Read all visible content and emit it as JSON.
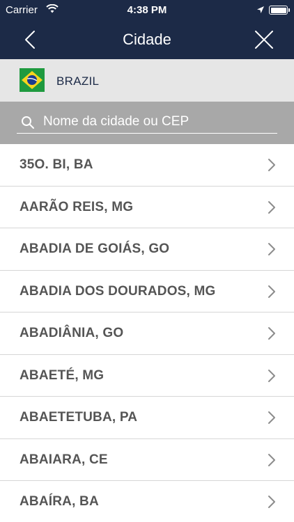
{
  "status_bar": {
    "carrier": "Carrier",
    "time": "4:38 PM"
  },
  "nav": {
    "title": "Cidade"
  },
  "country": {
    "name": "BRAZIL"
  },
  "search": {
    "placeholder": "Nome da cidade ou CEP"
  },
  "cities": [
    {
      "label": "35O. BI, BA"
    },
    {
      "label": "AARÃO REIS, MG"
    },
    {
      "label": "ABADIA DE GOIÁS, GO"
    },
    {
      "label": "ABADIA DOS DOURADOS, MG"
    },
    {
      "label": "ABADIÂNIA, GO"
    },
    {
      "label": "ABAETÉ, MG"
    },
    {
      "label": "ABAETETUBA, PA"
    },
    {
      "label": "ABAIARA, CE"
    },
    {
      "label": "ABAÍRA, BA"
    }
  ],
  "colors": {
    "header": "#1c2a47",
    "country_bar": "#e6e6e6",
    "search_bar": "#a8a8a8",
    "row_text": "#555555"
  }
}
